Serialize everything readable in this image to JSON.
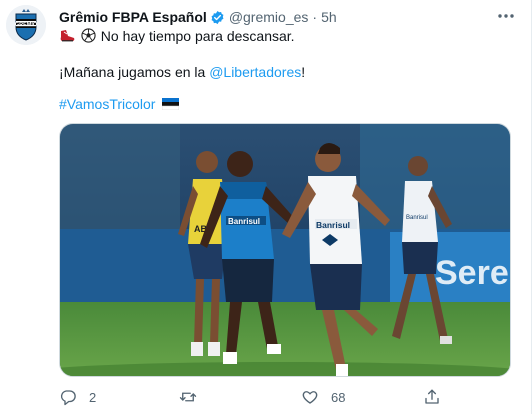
{
  "tweet": {
    "author_name": "Grêmio FBPA Español",
    "handle": "@gremio_es",
    "separator": "·",
    "time": "5h",
    "line1_text": "No hay tiempo para descansar.",
    "line2_prefix": "¡Mañana jugamos en la ",
    "line2_mention": "@Libertadores",
    "line2_suffix": "!",
    "hashtag": "#VamosTricolor",
    "avatar_text": "GRÊMIO",
    "media_text_1": "Banrisul",
    "media_text_2": "Banrisul",
    "media_text_3": "Banrisul",
    "media_text_bg": "Sere"
  },
  "actions": {
    "replies": "2",
    "retweets": "",
    "likes": "68"
  },
  "colors": {
    "link": "#1d9bf0",
    "verified": "#1d9bf0",
    "muted": "#536471",
    "club_blue": "#0d80bf"
  },
  "icons": [
    "verified-badge-icon",
    "more-icon",
    "boot-emoji",
    "ball-emoji",
    "estonia-flag-emoji",
    "reply-icon",
    "retweet-icon",
    "like-icon",
    "share-icon"
  ]
}
